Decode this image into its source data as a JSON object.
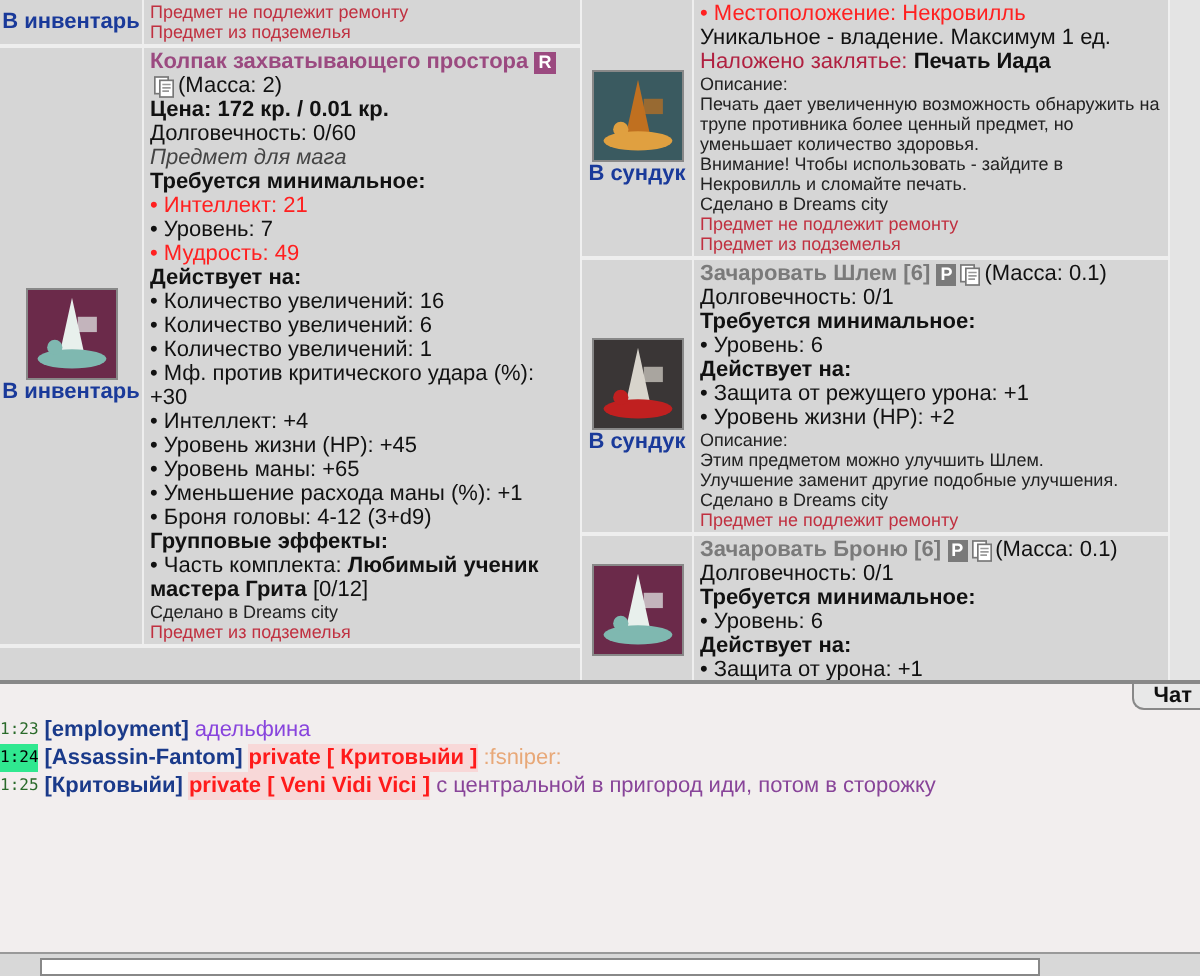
{
  "inventory": {
    "columns": [
      {
        "items": [
          {
            "action": "В инвентарь",
            "has_image": false,
            "lines": [
              {
                "kind": "note_red",
                "text": "Предмет не подлежит ремонту"
              },
              {
                "kind": "note_red",
                "text": "Предмет из подземелья"
              }
            ]
          },
          {
            "action": "В инвентарь",
            "has_image": true,
            "lines": [
              {
                "kind": "title",
                "text": "Колпак захватывающего простора",
                "color": "#9b4a80",
                "badge": "R",
                "mass": "(Масса: 2)"
              },
              {
                "kind": "price",
                "text": "Цена: 172 кр. / 0.01 кр."
              },
              {
                "kind": "text",
                "text": "Долговечность: 0/60"
              },
              {
                "kind": "italic",
                "text": "Предмет для мага"
              },
              {
                "kind": "heading",
                "text": "Требуется минимальное:"
              },
              {
                "kind": "requirement",
                "text": "• Интеллект: 21",
                "unmet": true
              },
              {
                "kind": "requirement",
                "text": "• Уровень: 7",
                "unmet": false
              },
              {
                "kind": "requirement",
                "text": "• Мудрость: 49",
                "unmet": true
              },
              {
                "kind": "heading",
                "text": "Действует на:"
              },
              {
                "kind": "text",
                "text": "• Количество увеличений: 16"
              },
              {
                "kind": "text",
                "text": "• Количество увеличений: 6"
              },
              {
                "kind": "text",
                "text": "• Количество увеличений: 1"
              },
              {
                "kind": "text",
                "text": "• Мф. против критического удара (%): +30"
              },
              {
                "kind": "text",
                "text": "• Интеллект: +4"
              },
              {
                "kind": "text",
                "text": "• Уровень жизни (HP): +45"
              },
              {
                "kind": "text",
                "text": "• Уровень маны: +65"
              },
              {
                "kind": "text",
                "text": "• Уменьшение расхода маны (%): +1"
              },
              {
                "kind": "text",
                "text": "• Броня головы: 4-12 (3+d9)"
              },
              {
                "kind": "heading",
                "text": "Групповые эффекты:"
              },
              {
                "kind": "rich",
                "text": "• Часть комплекта: **Любимый ученик мастера Грита** [0/12]"
              },
              {
                "kind": "note",
                "text": "Сделано в Dreams city"
              },
              {
                "kind": "note_red",
                "text": "Предмет из подземелья"
              }
            ]
          }
        ]
      },
      {
        "items": [
          {
            "action": "В сундук",
            "has_image": true,
            "lines": [
              {
                "kind": "alert",
                "text": "• Местоположение: Некровилль"
              },
              {
                "kind": "text",
                "text": "Уникальное - владение. Максимум 1 ед."
              },
              {
                "kind": "spell",
                "label": "Наложено заклятье:",
                "value": "Печать Иада"
              },
              {
                "kind": "note",
                "text": "Описание:"
              },
              {
                "kind": "note",
                "text": "Печать дает увеличенную возможность обнаружить на трупе противника более ценный предмет, но уменьшает количество здоровья."
              },
              {
                "kind": "note",
                "text": "Внимание! Чтобы использовать - зайдите в Некровилль и сломайте печать."
              },
              {
                "kind": "note",
                "text": "Сделано в Dreams city"
              },
              {
                "kind": "note_red",
                "text": "Предмет не подлежит ремонту"
              },
              {
                "kind": "note_red",
                "text": "Предмет из подземелья"
              }
            ]
          },
          {
            "action": "В сундук",
            "has_image": true,
            "lines": [
              {
                "kind": "title",
                "text": "Зачаровать Шлем [6]",
                "color": "#7a7a7a",
                "badge": "P",
                "mass": "(Масса: 0.1)"
              },
              {
                "kind": "text",
                "text": "Долговечность: 0/1"
              },
              {
                "kind": "heading",
                "text": "Требуется минимальное:"
              },
              {
                "kind": "requirement",
                "text": "• Уровень: 6",
                "unmet": false
              },
              {
                "kind": "heading",
                "text": "Действует на:"
              },
              {
                "kind": "text",
                "text": "• Защита от режущего урона: +1"
              },
              {
                "kind": "text",
                "text": "• Уровень жизни (HP): +2"
              },
              {
                "kind": "note",
                "text": "Описание:"
              },
              {
                "kind": "note",
                "text": "Этим предметом можно улучшить Шлем."
              },
              {
                "kind": "note",
                "text": "Улучшение заменит другие подобные улучшения."
              },
              {
                "kind": "note",
                "text": "Сделано в Dreams city"
              },
              {
                "kind": "note_red",
                "text": "Предмет не подлежит ремонту"
              }
            ]
          },
          {
            "has_image": true,
            "lines": [
              {
                "kind": "title",
                "text": "Зачаровать Броню [6]",
                "color": "#7a7a7a",
                "badge": "P",
                "mass": "(Масса: 0.1)"
              },
              {
                "kind": "text",
                "text": "Долговечность: 0/1"
              },
              {
                "kind": "heading",
                "text": "Требуется минимальное:"
              },
              {
                "kind": "requirement",
                "text": "• Уровень: 6",
                "unmet": false
              },
              {
                "kind": "heading",
                "text": "Действует на:"
              },
              {
                "kind": "text",
                "text": "• Защита от урона: +1"
              }
            ]
          }
        ]
      }
    ]
  },
  "chat": {
    "tab": "Чат",
    "messages": [
      {
        "time": "1:23",
        "highlighted": false,
        "author": "[employment]",
        "text": "адельфина",
        "color": "#8844dd"
      },
      {
        "time": "1:24",
        "highlighted": true,
        "author": "[Assassin-Fantom]",
        "private": "private [ Критовыйи ]",
        "text": ":fsniper:",
        "color": "#e8a878"
      },
      {
        "time": "1:25",
        "highlighted": false,
        "author": "[Критовыйи]",
        "private": "private [ Veni Vidi Vici ]",
        "text": "с центральной в пригород иди, потом в сторожку",
        "color": "#884499"
      }
    ]
  }
}
